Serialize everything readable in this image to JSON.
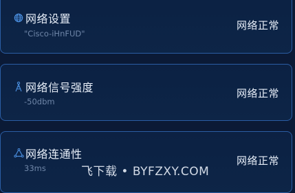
{
  "cards": [
    {
      "title": "网络设置",
      "subtitle": "\"Cisco-iHnFUD\"",
      "status": "网络正常",
      "icon": "globe-icon"
    },
    {
      "title": "网络信号强度",
      "subtitle": "-50dbm",
      "status": "网络正常",
      "icon": "signal-tower-icon"
    },
    {
      "title": "网络连通性",
      "subtitle": "33ms",
      "status": "网络正常",
      "icon": "connectivity-icon"
    }
  ],
  "watermark": "飞下载 • BYFZXY.COM",
  "colors": {
    "background": "#0b1a36",
    "card_border": "#2b5ea5",
    "icon_accent": "#4a8fe0",
    "title_text": "#e7eef8",
    "subtitle_text": "#6f86a8"
  }
}
